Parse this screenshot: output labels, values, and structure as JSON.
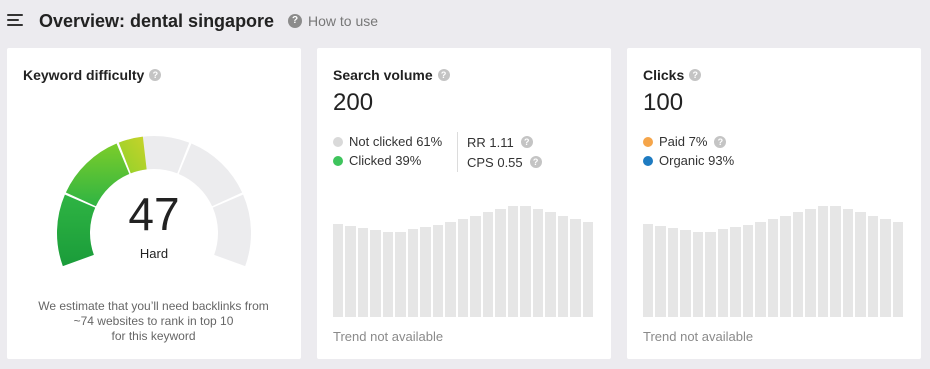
{
  "header": {
    "title": "Overview: dental singapore",
    "how_to_use": "How to use"
  },
  "keyword_difficulty": {
    "title": "Keyword difficulty",
    "value": "47",
    "label": "Hard",
    "score": 47,
    "estimate_lines": [
      "We estimate that you’ll need backlinks from",
      "~74 websites to rank in top 10",
      "for this keyword"
    ]
  },
  "search_volume": {
    "title": "Search volume",
    "value": "200",
    "legend": [
      {
        "label": "Not clicked 61%",
        "color": "#d9d9d9"
      },
      {
        "label": "Clicked 39%",
        "color": "#3ec45c"
      }
    ],
    "metrics": [
      {
        "label": "RR 1.11"
      },
      {
        "label": "CPS 0.55"
      }
    ],
    "trend_text": "Trend not available",
    "bar_levels": [
      0.82,
      0.8,
      0.78,
      0.76,
      0.75,
      0.75,
      0.77,
      0.79,
      0.81,
      0.83,
      0.86,
      0.89,
      0.92,
      0.95,
      0.97,
      0.97,
      0.95,
      0.92,
      0.89,
      0.86,
      0.83
    ]
  },
  "clicks": {
    "title": "Clicks",
    "value": "100",
    "legend": [
      {
        "label": "Paid 7%",
        "color": "#f5a54a"
      },
      {
        "label": "Organic 93%",
        "color": "#1e7bc1"
      }
    ],
    "trend_text": "Trend not available",
    "bar_levels": [
      0.82,
      0.8,
      0.78,
      0.76,
      0.75,
      0.75,
      0.77,
      0.79,
      0.81,
      0.83,
      0.86,
      0.89,
      0.92,
      0.95,
      0.97,
      0.97,
      0.95,
      0.92,
      0.89,
      0.86,
      0.83
    ]
  }
}
